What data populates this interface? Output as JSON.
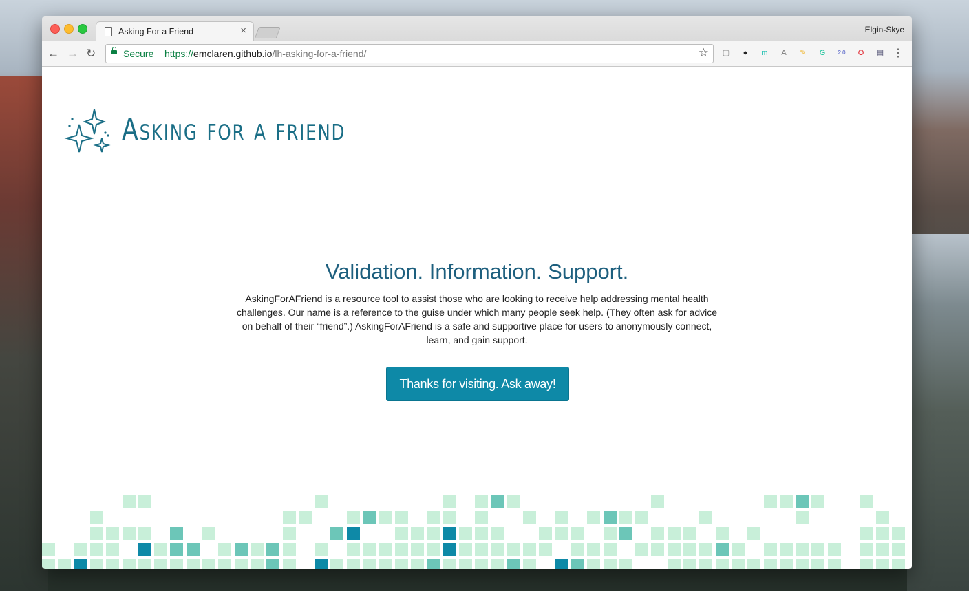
{
  "browser": {
    "tab_title": "Asking For a Friend",
    "tab_close": "×",
    "profile_name": "Elgin-Skye",
    "nav": {
      "back": "←",
      "forward": "→",
      "reload": "↻"
    },
    "address": {
      "security_label": "Secure",
      "url_scheme": "https://",
      "url_host": "emclaren.github.io",
      "url_path": "/lh-asking-for-a-friend/"
    },
    "bookmark_star": "☆",
    "extensions": [
      {
        "name": "page-icon",
        "glyph": "▢",
        "color": "#888888"
      },
      {
        "name": "github-icon",
        "glyph": "●",
        "color": "#222222"
      },
      {
        "name": "m-extension-icon",
        "glyph": "m",
        "color": "#1bbfb0"
      },
      {
        "name": "angular-icon",
        "glyph": "A",
        "color": "#7a7a7a"
      },
      {
        "name": "note-icon",
        "glyph": "✎",
        "color": "#f0b429"
      },
      {
        "name": "grammarly-icon",
        "glyph": "G",
        "color": "#15c39a"
      },
      {
        "name": "version-icon",
        "glyph": "2.0",
        "color": "#3b4cc0"
      },
      {
        "name": "opera-icon",
        "glyph": "O",
        "color": "#e0202a"
      },
      {
        "name": "reader-icon",
        "glyph": "▤",
        "color": "#555577"
      }
    ],
    "menu": "⋮"
  },
  "page": {
    "logo_text": "Asking for a friend",
    "headline": "Validation. Information. Support.",
    "description": "AskingForAFriend is a resource tool to assist those who are looking to receive help addressing mental health challenges. Our name is a reference to the guise under which many people seek help. (They often ask for advice on behalf of their “friend”.) AskingForAFriend is a safe and supportive place for users to anonymously connect, learn, and gain support.",
    "cta_label": "Thanks for visiting. Ask away!"
  },
  "colors": {
    "brand": "#1a6e86",
    "headline": "#1d5f7e",
    "button": "#0e89a7",
    "tile_light": "#c8efd9",
    "tile_mid": "#6cc6b8",
    "tile_dark": "#0e89a7"
  }
}
